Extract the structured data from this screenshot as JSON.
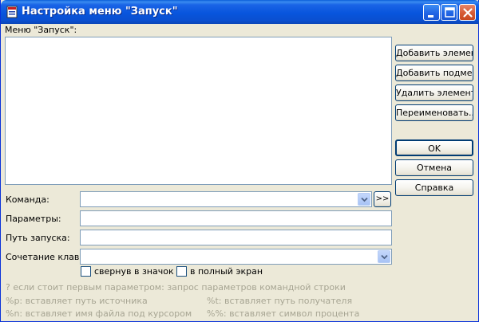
{
  "window": {
    "title": "Настройка меню \"Запуск\"",
    "title_bar_color": "#0a56dc",
    "close_color": "#d65a34"
  },
  "menu_label": "Меню \"Запуск\":",
  "side_buttons": {
    "add_item": "Добавить элемент",
    "add_submenu": "Добавить подменю",
    "delete_item": "Удалить элемент",
    "rename": "Переименовать...",
    "ok": "OK",
    "cancel": "Отмена",
    "help": "Справка"
  },
  "fields": {
    "command_label": "Команда:",
    "command_value": "",
    "insert_button": ">>",
    "params_label": "Параметры:",
    "params_value": "",
    "start_path_label": "Путь запуска:",
    "start_path_value": "",
    "hotkey_label": "Сочетание клавиш:",
    "hotkey_value": ""
  },
  "checkboxes": {
    "minimized": {
      "label": "свернув в значок",
      "checked": false
    },
    "fullscreen": {
      "label": "в полный экран",
      "checked": false
    }
  },
  "hints": {
    "line1": "? если стоит первым параметром: запрос параметров командной строки",
    "line2_left": "%p: вставляет путь источника",
    "line2_right": "%t: вставляет путь получателя",
    "line3_left": "%n: вставляет имя файла под курсором",
    "line3_right": "%%: вставляет символ процента"
  }
}
